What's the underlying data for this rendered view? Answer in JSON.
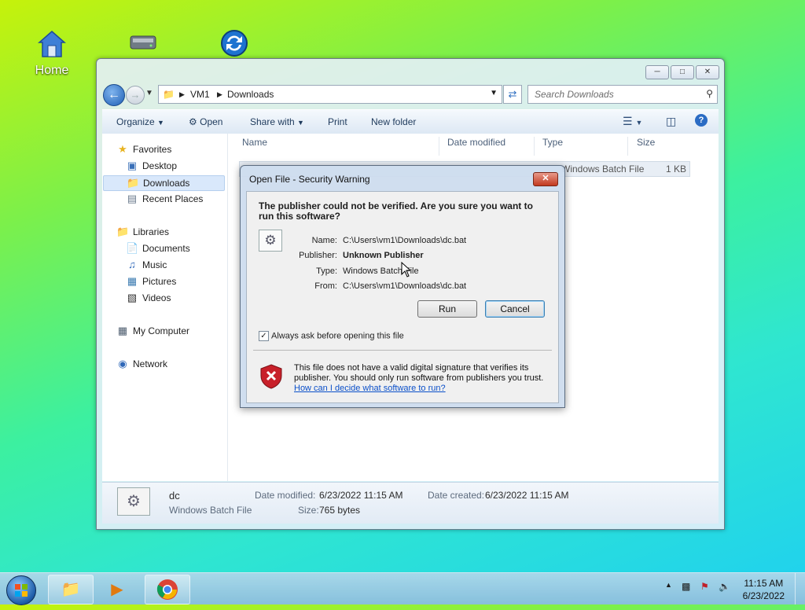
{
  "desktop": {
    "icons": [
      {
        "label": "Home",
        "icon": "home-icon"
      },
      {
        "label": "",
        "icon": "drive-icon"
      },
      {
        "label": "",
        "icon": "sync-icon"
      }
    ]
  },
  "explorer": {
    "caption_buttons": [
      "minimize",
      "maximize",
      "close"
    ],
    "breadcrumb": [
      "VM1",
      "Downloads"
    ],
    "search_placeholder": "Search Downloads",
    "toolbar": {
      "organize": "Organize",
      "open": "Open",
      "share_with": "Share with",
      "print": "Print",
      "new_folder": "New folder"
    },
    "sidebar": {
      "favorites": "Favorites",
      "favorites_items": [
        "Desktop",
        "Downloads",
        "Recent Places"
      ],
      "selected": "Downloads",
      "libraries": "Libraries",
      "libraries_items": [
        "Documents",
        "Music",
        "Pictures",
        "Videos"
      ],
      "computer": "My Computer",
      "network": "Network"
    },
    "columns": [
      "Name",
      "Date modified",
      "Type",
      "Size"
    ],
    "file_row": {
      "type": "Windows Batch File",
      "size": "1 KB"
    },
    "details": {
      "name": "dc",
      "type": "Windows Batch File",
      "date_modified_label": "Date modified:",
      "date_modified": "6/23/2022 11:15 AM",
      "date_created_label": "Date created:",
      "date_created": "6/23/2022 11:15 AM",
      "size_label": "Size:",
      "size": "765 bytes"
    }
  },
  "dialog": {
    "title": "Open File - Security Warning",
    "question": "The publisher could not be verified.  Are you sure you want to run this software?",
    "fields": {
      "name_label": "Name:",
      "name": "C:\\Users\\vm1\\Downloads\\dc.bat",
      "publisher_label": "Publisher:",
      "publisher": "Unknown Publisher",
      "type_label": "Type:",
      "type": "Windows Batch File",
      "from_label": "From:",
      "from": "C:\\Users\\vm1\\Downloads\\dc.bat"
    },
    "run_button": "Run",
    "cancel_button": "Cancel",
    "checkbox_label": "Always ask before opening this file",
    "checkbox_checked": true,
    "warning_text": "This file does not have a valid digital signature that verifies its publisher.  You should only run software from publishers you trust.",
    "help_link": "How can I decide what software to run?"
  },
  "taskbar": {
    "time": "11:15 AM",
    "date": "6/23/2022"
  }
}
